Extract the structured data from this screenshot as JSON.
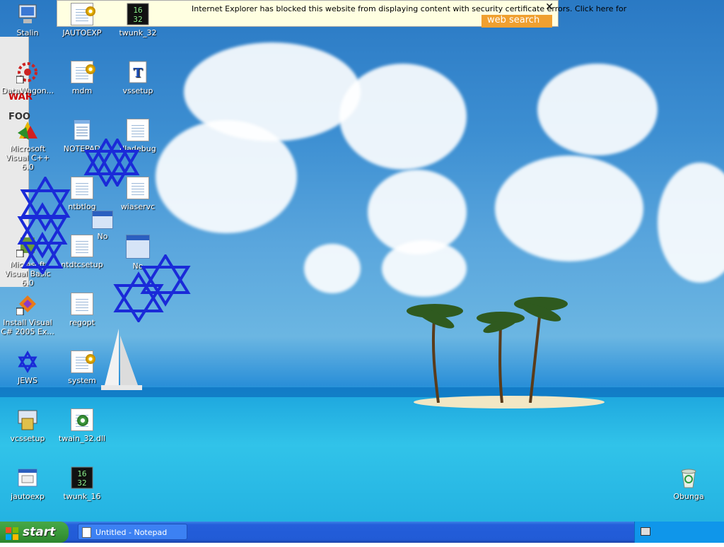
{
  "ie_info_bar": {
    "message": "Internet Explorer has blocked this website from displaying content with security certificate errors. Click here for",
    "web_search": "web search"
  },
  "left_window": {
    "text1": "WAR",
    "text2": "FOO"
  },
  "desktop_icons": [
    {
      "label": "Stalin",
      "icon": "computer-icon"
    },
    {
      "label": "JAUTOEXP",
      "icon": "gear-document-icon"
    },
    {
      "label": "twunk_32",
      "icon": "16-32-icon"
    },
    {
      "label": "DataWagon...",
      "icon": "red-gear-shortcut-icon"
    },
    {
      "label": "mdm",
      "icon": "gear-document-icon"
    },
    {
      "label": "vssetup",
      "icon": "font-file-icon"
    },
    {
      "label": "Microsoft Visual C++ 6.0",
      "icon": "visual-cpp-icon"
    },
    {
      "label": "NOTEPAD",
      "icon": "notepad-icon"
    },
    {
      "label": "dladebug",
      "icon": "text-document-icon"
    },
    {
      "label": "ntbtlog",
      "icon": "text-document-icon"
    },
    {
      "label": "wiaservc",
      "icon": "text-document-icon"
    },
    {
      "label": "No",
      "icon": "window-icon"
    },
    {
      "label": "Microsoft Visual Basic 6.0",
      "icon": "visual-basic-icon"
    },
    {
      "label": "ntdtcsetup",
      "icon": "text-document-icon"
    },
    {
      "label": "No",
      "icon": "window-icon"
    },
    {
      "label": "Install Visual C# 2005 Ex...",
      "icon": "visual-csharp-icon"
    },
    {
      "label": "regopt",
      "icon": "text-document-icon"
    },
    {
      "label": "JEWS",
      "icon": "star-icon"
    },
    {
      "label": "system",
      "icon": "gear-document-icon"
    },
    {
      "label": "vcssetup",
      "icon": "setup-icon"
    },
    {
      "label": "twain_32.dll",
      "icon": "dll-gear-icon"
    },
    {
      "label": "jautoexp",
      "icon": "exe-icon"
    },
    {
      "label": "twunk_16",
      "icon": "16-32-icon"
    },
    {
      "label": "Obunga",
      "icon": "recycle-bin-icon"
    }
  ],
  "taskbar": {
    "start_label": "start",
    "tasks": [
      {
        "label": "Untitled - Notepad"
      }
    ]
  },
  "colors": {
    "accent": "#245edb",
    "start_green": "#3a9a3a",
    "star_blue": "#1a2ad8"
  }
}
